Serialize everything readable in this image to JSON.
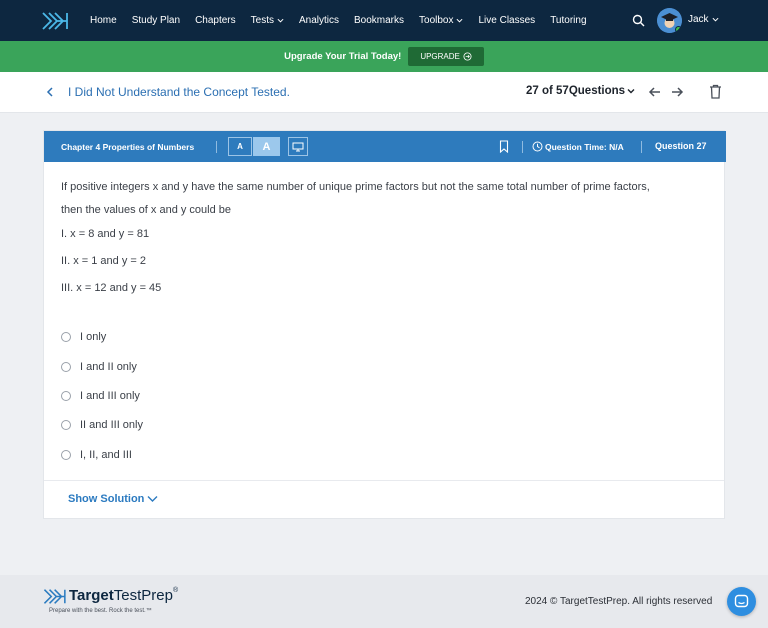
{
  "nav": {
    "items": [
      {
        "label": "Home",
        "dropdown": false
      },
      {
        "label": "Study Plan",
        "dropdown": false
      },
      {
        "label": "Chapters",
        "dropdown": false
      },
      {
        "label": "Tests",
        "dropdown": true
      },
      {
        "label": "Analytics",
        "dropdown": false
      },
      {
        "label": "Bookmarks",
        "dropdown": false
      },
      {
        "label": "Toolbox",
        "dropdown": true
      },
      {
        "label": "Live Classes",
        "dropdown": false
      },
      {
        "label": "Tutoring",
        "dropdown": false
      }
    ],
    "user_name": "Jack",
    "colors": {
      "nav_bg": "#0d2740",
      "accent": "#4bb8e8"
    }
  },
  "promo": {
    "text": "Upgrade Your Trial Today!",
    "button_label": "UPGRADE",
    "color": "#3aa45a"
  },
  "subheader": {
    "title": "I Did Not Understand the Concept Tested.",
    "question_counter": "27 of 57Questions"
  },
  "question": {
    "chapter": "Chapter 4 Properties of Numbers",
    "font_small_label": "A",
    "font_large_label": "A",
    "time_label": "Question Time: N/A",
    "number_label": "Question 27",
    "stem_line1": "If positive integers x and y have the same number of unique prime factors but not the same total number of prime factors,",
    "stem_line2": "then the values of x and y could be",
    "statements": [
      "I. x = 8 and y = 81",
      "II. x = 1 and y = 2",
      "III. x = 12 and y = 45"
    ],
    "choices": [
      "I only",
      "I and II only",
      "I and III only",
      "II and III only",
      "I, II, and III"
    ],
    "show_solution_label": "Show Solution",
    "header_color": "#2e7bbd"
  },
  "footer": {
    "brand_bold": "Target",
    "brand_light": "TestPrep",
    "brand_tm": "®",
    "tagline": "Prepare with the best. Rock the test.™",
    "copyright": "2024 © TargetTestPrep. All rights reserved"
  }
}
